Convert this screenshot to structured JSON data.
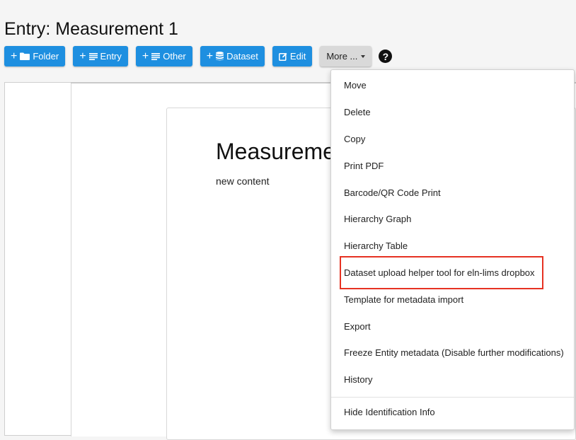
{
  "header": {
    "title": "Entry: Measurement 1"
  },
  "toolbar": {
    "folder_label": "Folder",
    "entry_label": "Entry",
    "other_label": "Other",
    "dataset_label": "Dataset",
    "edit_label": "Edit",
    "more_label": "More ...",
    "help_glyph": "?"
  },
  "content": {
    "heading": "Measuremen",
    "body": "new content"
  },
  "menu": {
    "items": [
      "Move",
      "Delete",
      "Copy",
      "Print PDF",
      "Barcode/QR Code Print",
      "Hierarchy Graph",
      "Hierarchy Table",
      "Dataset upload helper tool for eln-lims dropbox",
      "Template for metadata import",
      "Export",
      "Freeze Entity metadata (Disable further modifications)",
      "History"
    ],
    "footer_item": "Hide Identification Info"
  },
  "colors": {
    "primary_button": "#1e8fe0",
    "highlight_border": "#e63222"
  }
}
